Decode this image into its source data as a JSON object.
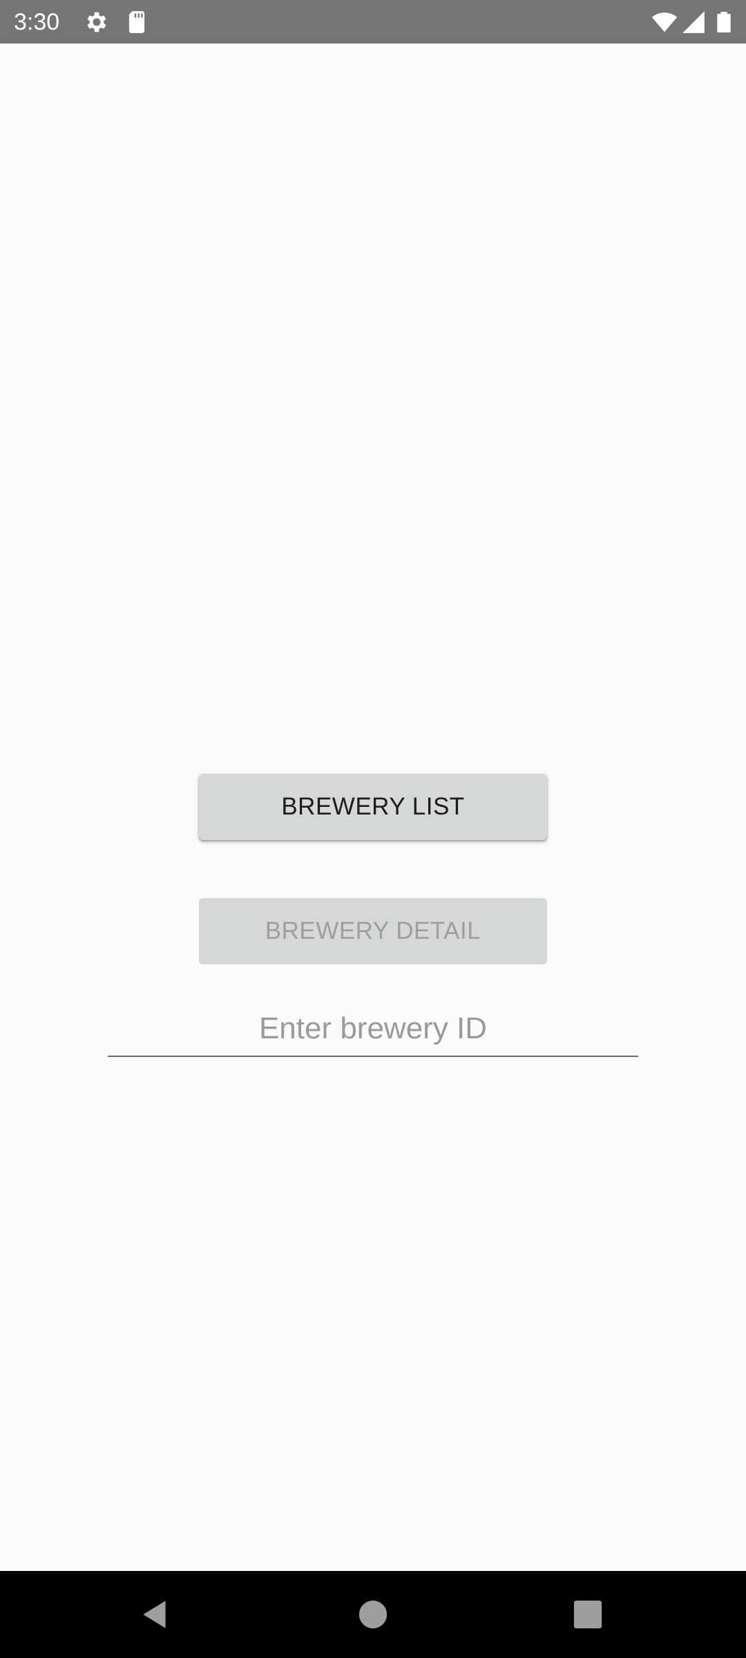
{
  "status_bar": {
    "time": "3:30",
    "icons": [
      "gear-icon",
      "sd-card-icon",
      "wifi-icon",
      "cellular-signal-icon",
      "battery-icon"
    ],
    "background_color": "#757575"
  },
  "main": {
    "brewery_list_button": {
      "label": "BREWERY LIST",
      "enabled": true
    },
    "brewery_detail_button": {
      "label": "BREWERY DETAIL",
      "enabled": false
    },
    "brewery_id_input": {
      "value": "",
      "placeholder": "Enter brewery ID"
    }
  },
  "nav_bar": {
    "icons": [
      "back-icon",
      "home-icon",
      "recents-icon"
    ],
    "background_color": "#000000"
  }
}
